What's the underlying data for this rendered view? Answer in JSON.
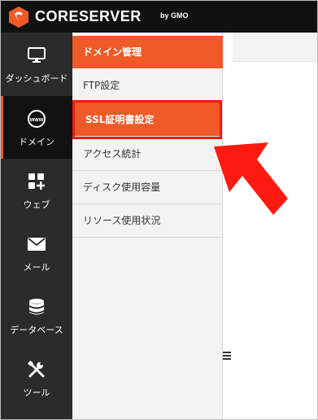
{
  "header": {
    "logo_text": "CORESERVER",
    "logo_sub": "by GMO"
  },
  "sidenav": {
    "items": [
      {
        "label": "ダッシュボード",
        "icon": "monitor-icon"
      },
      {
        "label": "ドメイン",
        "icon": "www-globe-icon"
      },
      {
        "label": "ウェブ",
        "icon": "apps-plus-icon"
      },
      {
        "label": "メール",
        "icon": "envelope-icon"
      },
      {
        "label": "データベース",
        "icon": "database-icon"
      },
      {
        "label": "ツール",
        "icon": "tools-icon"
      }
    ],
    "active_index": 1
  },
  "submenu": {
    "title": "ドメイン管理",
    "items": [
      {
        "label": "FTP設定"
      },
      {
        "label": "SSL証明書設定"
      },
      {
        "label": "アクセス統計"
      },
      {
        "label": "ディスク使用容量"
      },
      {
        "label": "リソース使用状況"
      }
    ],
    "selected_index": 1
  },
  "colors": {
    "accent": "#f05a28",
    "highlight_border": "#ee1c12",
    "pointer": "#ff1a10",
    "nav_bg": "#2b2b2b",
    "header_bg": "#111111"
  }
}
